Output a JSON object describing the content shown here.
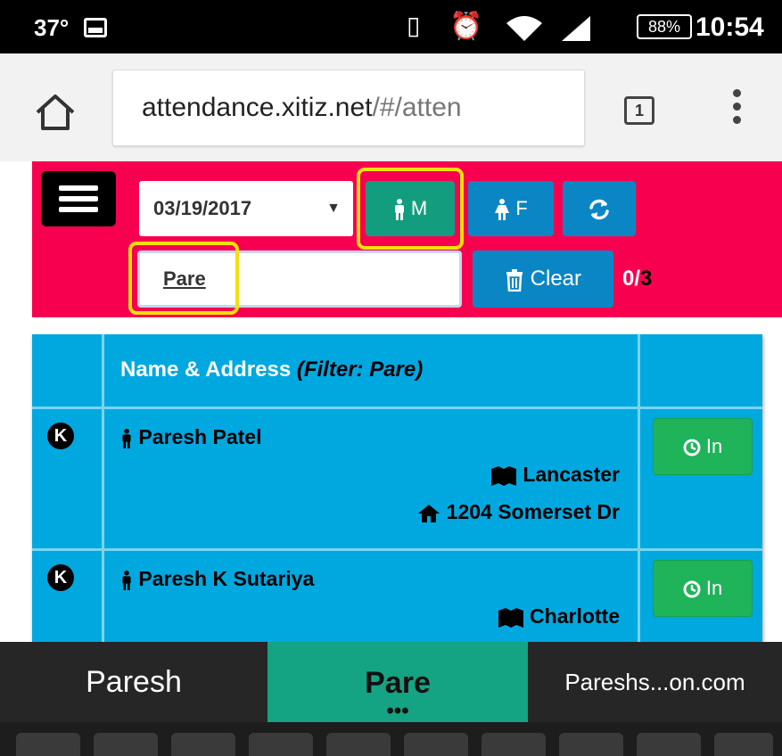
{
  "status_bar": {
    "temperature": "37°",
    "battery": "88%",
    "time": "10:54"
  },
  "browser": {
    "url_host": "attendance.xitiz.net",
    "url_path": "/#/atten",
    "tab_count": "1"
  },
  "toolbar": {
    "date": "03/19/2017",
    "male_label": "M",
    "female_label": "F",
    "filter_value": "Pare",
    "clear_label": "Clear",
    "count_checked": "0/",
    "count_total": "3"
  },
  "table": {
    "header_label": "Name & Address",
    "header_filter": "(Filter: Pare)",
    "rows": [
      {
        "badge": "K",
        "name": "Paresh Patel",
        "city": "Lancaster",
        "address": "1204 Somerset Dr",
        "action_label": "In"
      },
      {
        "badge": "K",
        "name": "Paresh K Sutariya",
        "city": "Charlotte",
        "action_label": "In"
      }
    ]
  },
  "keyboard": {
    "suggestions": [
      "Paresh",
      "Pare",
      "Pareshs...on.com"
    ],
    "more_dots": "•••"
  },
  "colors": {
    "toolbar_bg": "#f7004f",
    "table_bg": "#00a8e0",
    "male_btn": "#129d7f",
    "blue_btn": "#0b86c5",
    "in_btn": "#1fb35a",
    "highlight": "#f3e00c",
    "suggestion_active": "#14a383"
  }
}
